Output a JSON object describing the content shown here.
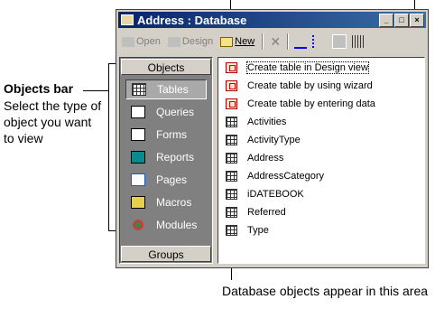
{
  "annotations": {
    "objects_bar_title": "Objects bar",
    "objects_bar_desc": "Select the type of object you want to view",
    "database_area_desc": "Database objects appear in this area"
  },
  "window": {
    "title": "Address : Database",
    "minimize_icon": "minimize-icon",
    "maximize_icon": "maximize-icon",
    "close_icon": "close-icon"
  },
  "toolbar": {
    "open_label": "Open",
    "design_label": "Design",
    "new_label": "New",
    "items": [
      "open",
      "design",
      "new",
      "delete",
      "large-icons",
      "small-icons",
      "list",
      "details"
    ]
  },
  "objects_bar": {
    "header": "Objects",
    "groups_label": "Groups",
    "items": [
      {
        "label": "Tables",
        "icon": "table-icon",
        "selected": true
      },
      {
        "label": "Queries",
        "icon": "query-icon",
        "selected": false
      },
      {
        "label": "Forms",
        "icon": "form-icon",
        "selected": false
      },
      {
        "label": "Reports",
        "icon": "report-icon",
        "selected": false
      },
      {
        "label": "Pages",
        "icon": "page-icon",
        "selected": false
      },
      {
        "label": "Macros",
        "icon": "macro-icon",
        "selected": false
      },
      {
        "label": "Modules",
        "icon": "module-icon",
        "selected": false
      }
    ]
  },
  "list": {
    "items": [
      {
        "label": "Create table in Design view",
        "icon": "wizard-icon"
      },
      {
        "label": "Create table by using wizard",
        "icon": "wizard-icon"
      },
      {
        "label": "Create table by entering data",
        "icon": "wizard-icon"
      },
      {
        "label": "Activities",
        "icon": "table-icon"
      },
      {
        "label": "ActivityType",
        "icon": "table-icon"
      },
      {
        "label": "Address",
        "icon": "table-icon"
      },
      {
        "label": "AddressCategory",
        "icon": "table-icon"
      },
      {
        "label": "iDATEBOOK",
        "icon": "table-icon"
      },
      {
        "label": "Referred",
        "icon": "table-icon"
      },
      {
        "label": "Type",
        "icon": "table-icon"
      }
    ]
  },
  "colors": {
    "title_start": "#0a246a",
    "title_end": "#3a6ea5",
    "face": "#d4d0c8",
    "objbar": "#808080"
  }
}
